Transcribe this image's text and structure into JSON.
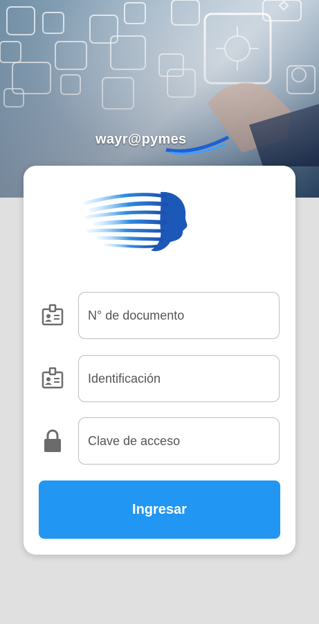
{
  "header": {
    "brand_text": "wayr@pymes"
  },
  "form": {
    "document_placeholder": "N° de documento",
    "identification_placeholder": "Identificación",
    "password_placeholder": "Clave de acceso",
    "submit_label": "Ingresar"
  },
  "icons": {
    "document": "id-badge-icon",
    "identification": "id-badge-icon",
    "password": "lock-icon"
  },
  "colors": {
    "primary": "#2196f3",
    "background": "#e0e0e0",
    "card": "#ffffff"
  }
}
